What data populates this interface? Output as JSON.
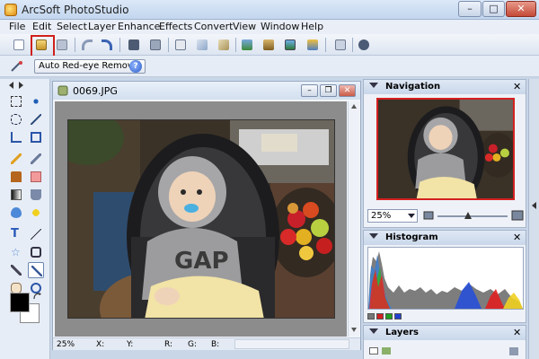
{
  "window": {
    "title": "ArcSoft PhotoStudio",
    "minimize": "–",
    "maximize": "□",
    "close": "✕"
  },
  "menu": [
    "File",
    "Edit",
    "Select",
    "Layer",
    "Enhance",
    "Effects",
    "Convert",
    "View",
    "Window",
    "Help"
  ],
  "toolbar": {
    "buttons": [
      "new-icon",
      "open-icon",
      "save-icon",
      "undo-icon",
      "redo-icon",
      "scan-icon",
      "print-icon",
      "import-icon",
      "copy-icon",
      "paste-icon",
      "image-icon",
      "album-icon",
      "frame-icon",
      "slideshow-icon",
      "settings-icon",
      "info-icon"
    ],
    "highlight_color": "#d0201a"
  },
  "optionbar": {
    "button": "Auto Red-eye Removal",
    "help": "?"
  },
  "document": {
    "title": "0069.JPG",
    "status": {
      "zoom": "25%",
      "x": "X:",
      "y": "Y:",
      "r": "R:",
      "g": "G:",
      "b": "B:"
    }
  },
  "panels": {
    "navigation": {
      "title": "Navigation",
      "zoom": "25%"
    },
    "histogram": {
      "title": "Histogram"
    },
    "layers": {
      "title": "Layers"
    }
  }
}
